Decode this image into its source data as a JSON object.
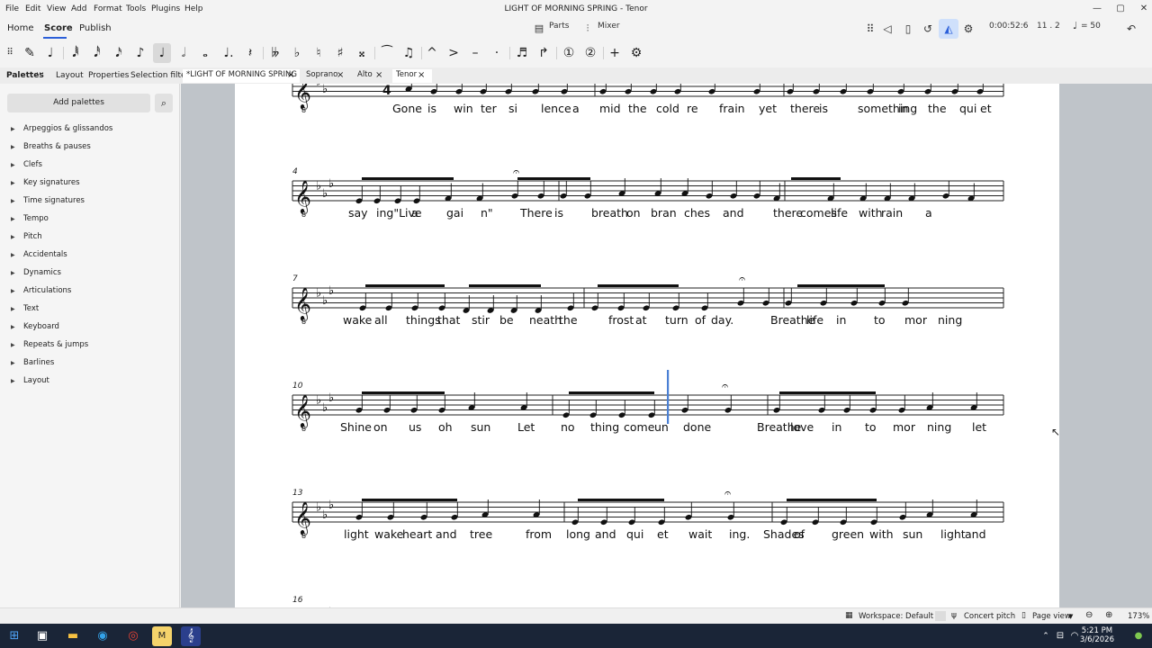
{
  "menu": {
    "items": [
      "File",
      "Edit",
      "View",
      "Add",
      "Format",
      "Tools",
      "Plugins",
      "Help"
    ]
  },
  "window": {
    "title": "LIGHT OF MORNING SPRING - Tenor",
    "minimize": "—",
    "maximize": "▢",
    "close": "✕"
  },
  "workspace_tabs": {
    "home": "Home",
    "score": "Score",
    "publish": "Publish"
  },
  "topbar": {
    "parts": "Parts",
    "mixer": "Mixer",
    "time": "0:00:52:6",
    "position": "11 . 2",
    "tempo": "= 50"
  },
  "panel_tabs": {
    "palettes": "Palettes",
    "layout": "Layout",
    "properties": "Properties",
    "selection_filter": "Selection filter"
  },
  "score_tabs": [
    "*LIGHT OF MORNING SPRING",
    "Soprano",
    "Alto",
    "Tenor"
  ],
  "palettes": {
    "add_label": "Add palettes",
    "items": [
      "Arpeggios & glissandos",
      "Breaths & pauses",
      "Clefs",
      "Key signatures",
      "Time signatures",
      "Tempo",
      "Pitch",
      "Accidentals",
      "Dynamics",
      "Articulations",
      "Text",
      "Keyboard",
      "Repeats & jumps",
      "Barlines",
      "Layout"
    ]
  },
  "score": {
    "time_sig_top": "4",
    "systems": [
      {
        "measure_no": "",
        "lyrics": [
          "Gone",
          "is",
          "win",
          "ter",
          "si",
          "lence",
          "a",
          "mid",
          "the",
          "cold",
          "re",
          "frain",
          "yet",
          "there",
          "is",
          "something",
          "in",
          "the",
          "qui",
          "et"
        ]
      },
      {
        "measure_no": "4",
        "lyrics": [
          "say",
          "ing\"Live",
          "a",
          "gai",
          "n\"",
          "There",
          "is",
          "breath",
          "on",
          "bran",
          "ches",
          "and",
          "there",
          "comes",
          "life",
          "with",
          "rain",
          "a"
        ]
      },
      {
        "measure_no": "7",
        "lyrics": [
          "wake",
          "all",
          "things",
          "that",
          "stir",
          "be",
          "neath",
          "the",
          "frost",
          "at",
          "turn",
          "of",
          "day.",
          "Breathe",
          "life",
          "in",
          "to",
          "mor",
          "ning"
        ]
      },
      {
        "measure_no": "10",
        "lyrics": [
          "Shine",
          "on",
          "us",
          "oh",
          "sun",
          "Let",
          "no",
          "thing",
          "come",
          "un",
          "done",
          "Breathe",
          "love",
          "in",
          "to",
          "mor",
          "ning",
          "let"
        ]
      },
      {
        "measure_no": "13",
        "lyrics": [
          "light",
          "wake",
          "heart",
          "and",
          "tree",
          "from",
          "long",
          "and",
          "qui",
          "et",
          "wait",
          "ing.",
          "Shades",
          "of",
          "green",
          "with",
          "sun",
          "light",
          "and"
        ]
      },
      {
        "measure_no": "16",
        "lyrics": []
      }
    ]
  },
  "statusbar": {
    "workspace": "Workspace: Default",
    "concert_pitch": "Concert pitch",
    "page_view": "Page view",
    "zoom": "173%"
  },
  "clock": {
    "time": "5:21 PM",
    "date": "3/6/2026"
  },
  "colors": {
    "accent": "#2b5fd9",
    "canvas": "#bfc4c9",
    "selection": "#4a7fd4",
    "taskbar": "#1a2537"
  }
}
